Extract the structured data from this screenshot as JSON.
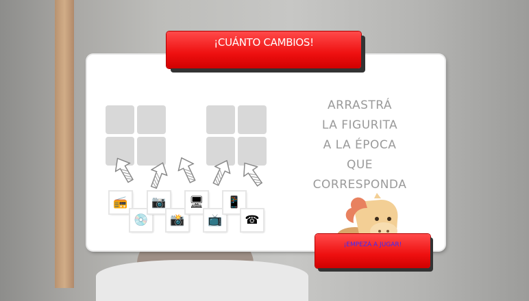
{
  "game": {
    "title": "¡CUÁNTO CAMBIOS!",
    "instruction_lines": [
      "ARRASTRÁ",
      "LA FIGURITA",
      "A LA ÉPOCA",
      "QUE CORRESPONDA"
    ],
    "start_button_label": "¡EMPEZÁ A JUGAR!"
  },
  "thumbnails": [
    {
      "icon": "radio-icon",
      "glyph": "📻"
    },
    {
      "icon": "vinyl-record-icon",
      "glyph": "💿"
    },
    {
      "icon": "digital-camera-icon",
      "glyph": "📷"
    },
    {
      "icon": "film-camera-icon",
      "glyph": "📸"
    },
    {
      "icon": "flatscreen-tv-icon",
      "glyph": "🖥"
    },
    {
      "icon": "old-tv-icon",
      "glyph": "📺"
    },
    {
      "icon": "smartphone-icon",
      "glyph": "📱"
    },
    {
      "icon": "rotary-phone-icon",
      "glyph": "☎"
    }
  ],
  "colors": {
    "banner_red": "#ee1010",
    "start_button_text": "#3a2cff",
    "instruction_gray": "#9a9a9a",
    "drop_cell_gray": "#d8d8d8"
  }
}
